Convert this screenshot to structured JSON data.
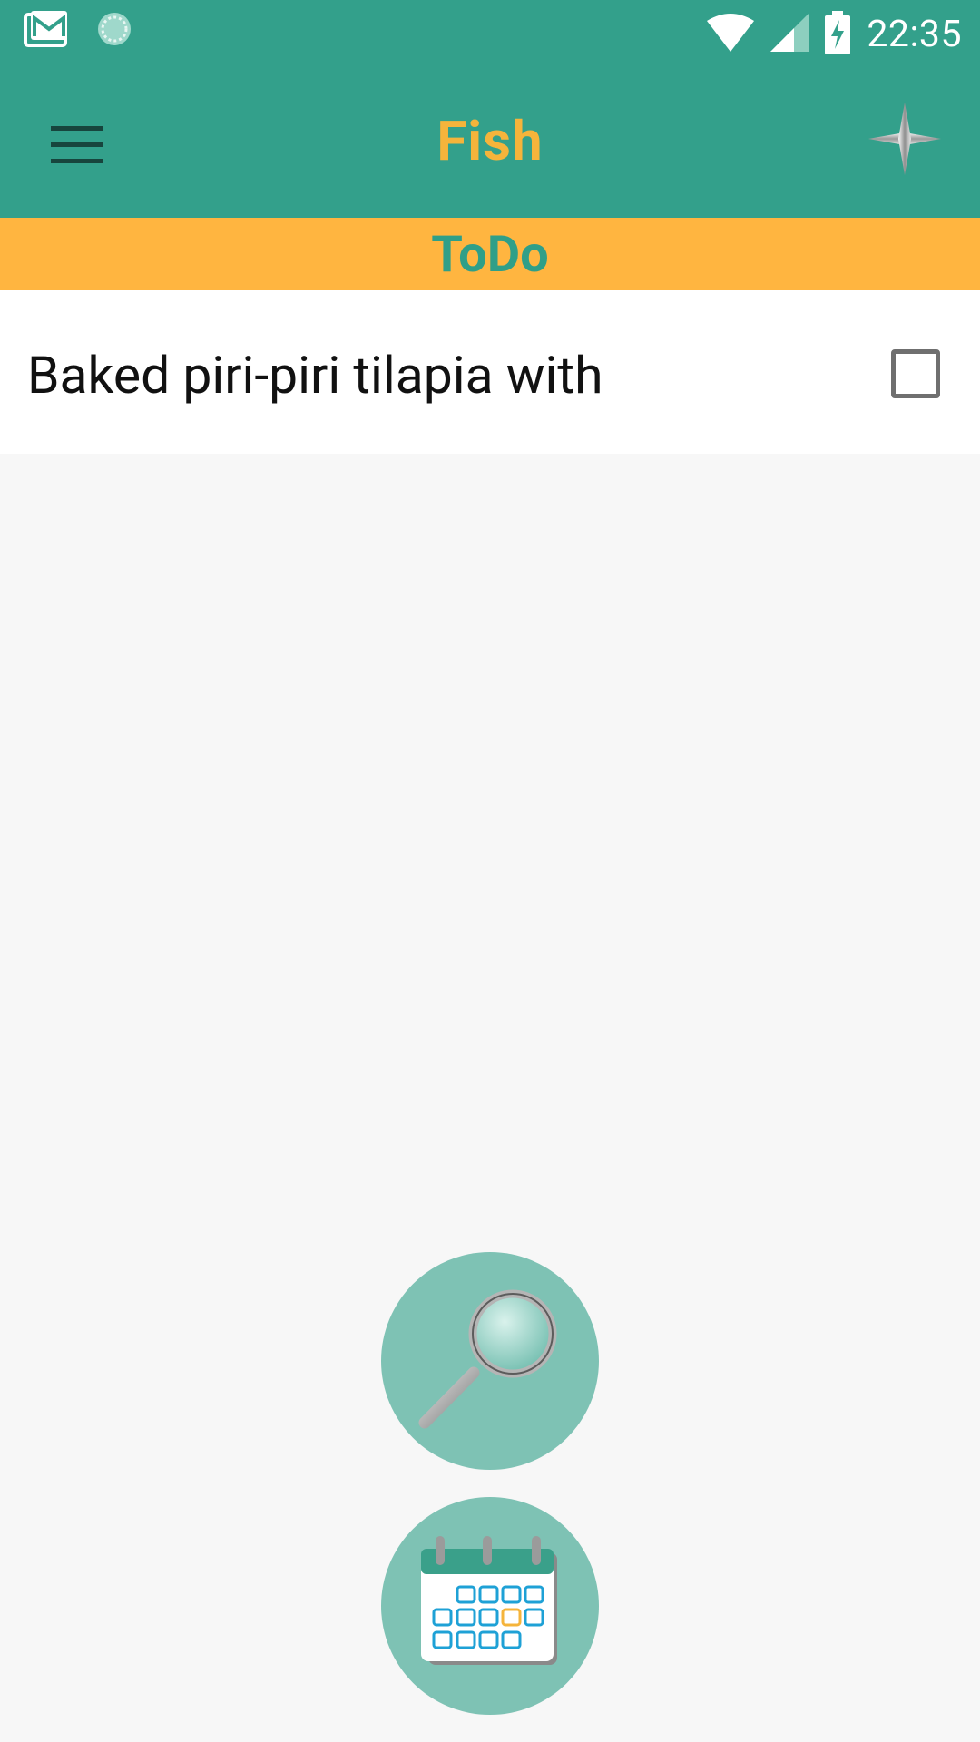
{
  "status_bar": {
    "time": "22:35",
    "icons": [
      "gmail-icon",
      "sync-icon",
      "wifi-icon",
      "signal-icon",
      "battery-charging-icon"
    ]
  },
  "app_bar": {
    "title": "Fish",
    "menu_icon": "hamburger-menu-icon",
    "add_icon": "plus-icon"
  },
  "section": {
    "label": "ToDo"
  },
  "list": {
    "items": [
      {
        "text": "Baked piri-piri tilapia with",
        "checked": false
      }
    ]
  },
  "fabs": {
    "search_icon": "magnifier-icon",
    "calendar_icon": "calendar-icon"
  },
  "colors": {
    "primary": "#33a08b",
    "accent": "#ffb540",
    "title": "#f5b43b",
    "fab": "#7ec2b4"
  }
}
